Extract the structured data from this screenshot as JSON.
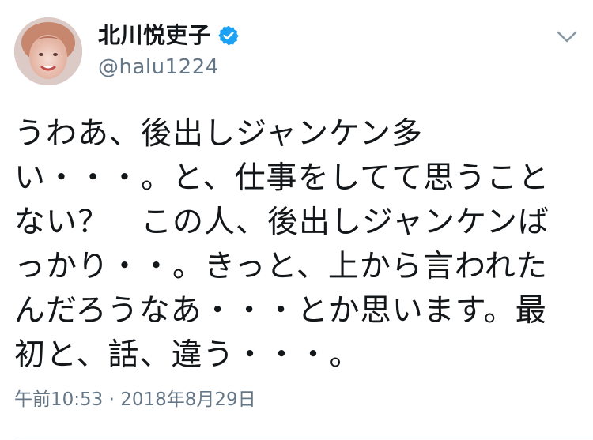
{
  "tweet": {
    "display_name": "北川悦吏子",
    "handle": "@halu1224",
    "body_lines": [
      "うわあ、後出しジャンケン多",
      "い・・・。と、仕事をしてて思うこと",
      "ない？　この人、後出しジャンケンば",
      "っかり・・。きっと、上から言われた",
      "んだろうなあ・・・とか思います。最",
      "初と、話、違う・・・。"
    ],
    "time": "午前10:53",
    "separator": " · ",
    "date": "2018年8月29日"
  },
  "icons": {
    "verified": "verified-badge-icon",
    "menu": "chevron-down-icon"
  },
  "colors": {
    "verified": "#1da1f2",
    "secondary_text": "#657786",
    "primary_text": "#14171a"
  }
}
